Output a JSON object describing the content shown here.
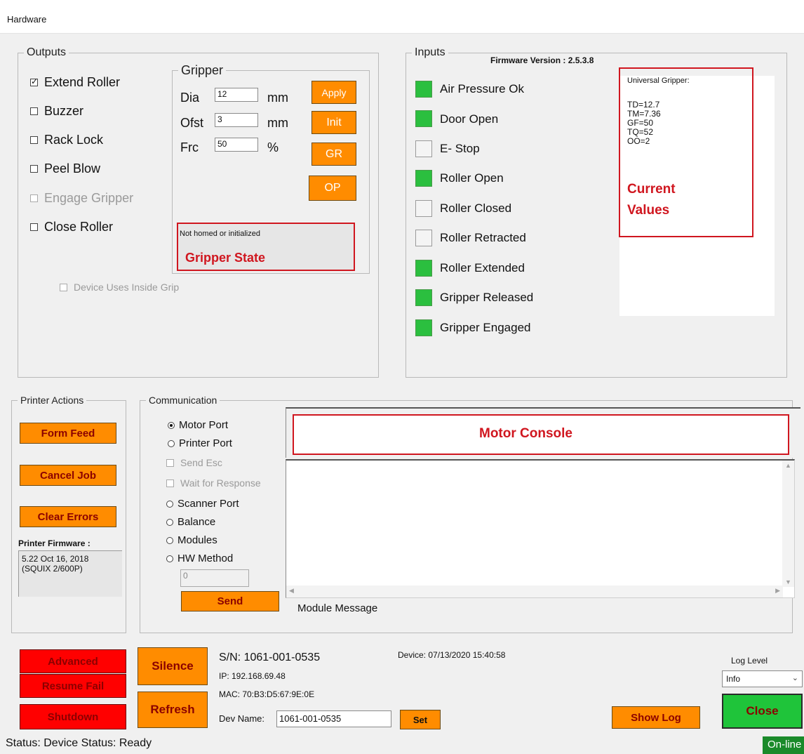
{
  "window": {
    "title": "Hardware"
  },
  "outputs": {
    "legend": "Outputs",
    "checkboxes": [
      {
        "label": "Extend Roller",
        "checked": true,
        "enabled": true
      },
      {
        "label": "Buzzer",
        "checked": false,
        "enabled": true
      },
      {
        "label": "Rack Lock",
        "checked": false,
        "enabled": true
      },
      {
        "label": "Peel Blow",
        "checked": false,
        "enabled": true
      },
      {
        "label": "Engage Gripper",
        "checked": false,
        "enabled": false
      },
      {
        "label": "Close Roller",
        "checked": false,
        "enabled": true
      }
    ],
    "inside_grip_label": "Device Uses Inside Grip"
  },
  "gripper": {
    "legend": "Gripper",
    "dia_label": "Dia",
    "dia_value": "12",
    "dia_unit": "mm",
    "ofst_label": "Ofst",
    "ofst_value": "3",
    "ofst_unit": "mm",
    "frc_label": "Frc",
    "frc_value": "50",
    "frc_unit": "%",
    "buttons": {
      "apply": "Apply",
      "init": "Init",
      "gr": "GR",
      "op": "OP"
    },
    "state_text": "Not homed or initialized",
    "state_annotation": "Gripper State"
  },
  "inputs": {
    "legend": "Inputs",
    "firmware_version": "Firmware Version : 2.5.3.8",
    "items": [
      {
        "label": "Air Pressure Ok",
        "on": true
      },
      {
        "label": "Door Open",
        "on": true
      },
      {
        "label": "E- Stop",
        "on": false
      },
      {
        "label": "Roller Open",
        "on": true
      },
      {
        "label": "Roller Closed",
        "on": false
      },
      {
        "label": "Roller Retracted",
        "on": false
      },
      {
        "label": "Roller Extended",
        "on": true
      },
      {
        "label": "Gripper Released",
        "on": true
      },
      {
        "label": "Gripper Engaged",
        "on": true
      }
    ],
    "current_values": {
      "title": "Universal Gripper:",
      "lines": [
        "TD=12.7",
        "TM=7.36",
        "GF=50",
        "TQ=52",
        "OO=2"
      ],
      "annotation_line1": "Current",
      "annotation_line2": "Values"
    },
    "colors": {
      "on": "#2bbf3f",
      "off": "#f4f4f4"
    }
  },
  "printer_actions": {
    "legend": "Printer Actions",
    "form_feed": "Form Feed",
    "cancel_job": "Cancel Job",
    "clear_errors": "Clear Errors",
    "firmware_label": "Printer Firmware :",
    "firmware_line1": "5.22 Oct 16, 2018",
    "firmware_line2": "(SQUIX 2/600P)"
  },
  "communication": {
    "legend": "Communication",
    "motor_port": "Motor Port",
    "printer_port": "Printer Port",
    "send_esc": "Send Esc",
    "wait_response": "Wait for Response",
    "scanner_port": "Scanner Port",
    "balance": "Balance",
    "modules": "Modules",
    "hw_method": "HW Method",
    "hw_value": "0",
    "send_button": "Send",
    "motor_console": "Motor Console",
    "module_message": "Module Message"
  },
  "footer": {
    "advanced": "Advanced",
    "resume_fail": "Resume Fail",
    "shutdown": "Shutdown",
    "silence": "Silence",
    "refresh": "Refresh",
    "sn": "S/N: 1061-001-0535",
    "ip": "IP: 192.168.69.48",
    "mac": "MAC: 70:B3:D5:67:9E:0E",
    "dev_name_label": "Dev Name:",
    "dev_name_value": "1061-001-0535",
    "set": "Set",
    "device_date": "Device: 07/13/2020 15:40:58",
    "show_log": "Show Log",
    "log_level_label": "Log Level",
    "log_level_value": "Info",
    "close": "Close",
    "status": "Status: Device Status: Ready",
    "online": "On-line"
  }
}
